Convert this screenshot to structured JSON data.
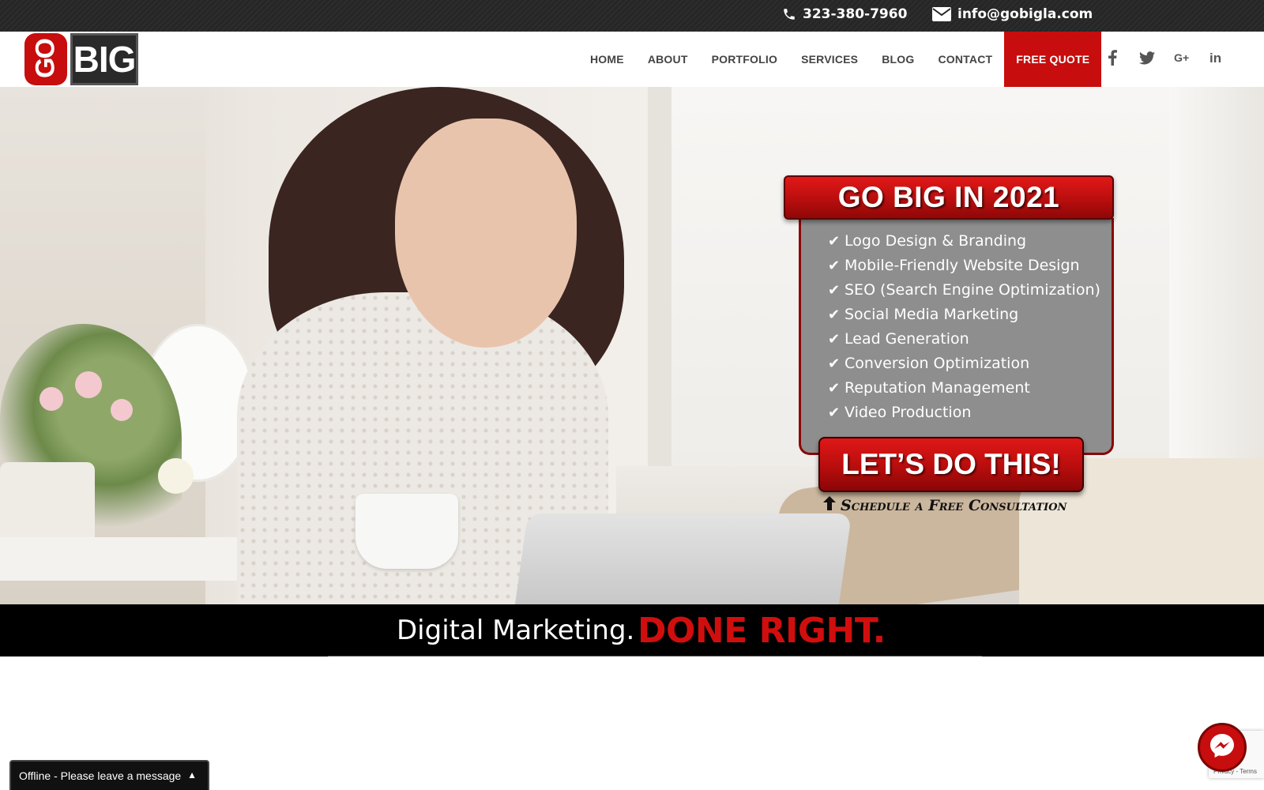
{
  "topbar": {
    "phone": "323-380-7960",
    "email": "info@gobigla.com",
    "phone_icon": "phone-icon",
    "email_icon": "envelope-icon"
  },
  "logo": {
    "text_go": "GO",
    "text_big": "BIG"
  },
  "nav": {
    "items": [
      "HOME",
      "ABOUT",
      "PORTFOLIO",
      "SERVICES",
      "BLOG",
      "CONTACT"
    ],
    "cta": "FREE QUOTE"
  },
  "social": [
    {
      "name": "facebook-icon",
      "glyph": "f"
    },
    {
      "name": "twitter-icon",
      "glyph": "🐦"
    },
    {
      "name": "google-plus-icon",
      "glyph": "G+"
    },
    {
      "name": "linkedin-icon",
      "glyph": "in"
    }
  ],
  "promo": {
    "heading": "GO BIG IN 2021",
    "services": [
      "Logo Design & Branding",
      "Mobile-Friendly Website Design",
      "SEO (Search Engine Optimization)",
      "Social Media Marketing",
      "Lead Generation",
      "Conversion Optimization",
      "Reputation Management",
      "Video Production"
    ],
    "cta": "LET’S DO THIS!",
    "schedule": "Schedule a Free Consultation"
  },
  "tagline": {
    "part1": "Digital Marketing.",
    "part2": "DONE RIGHT."
  },
  "chat": {
    "label": "Offline - Please leave a message"
  },
  "recaptcha": {
    "terms": "Privacy - Terms"
  },
  "colors": {
    "brand_red": "#c70d0d",
    "topbar": "#262626",
    "promo_gray": "#8e8e8e"
  }
}
